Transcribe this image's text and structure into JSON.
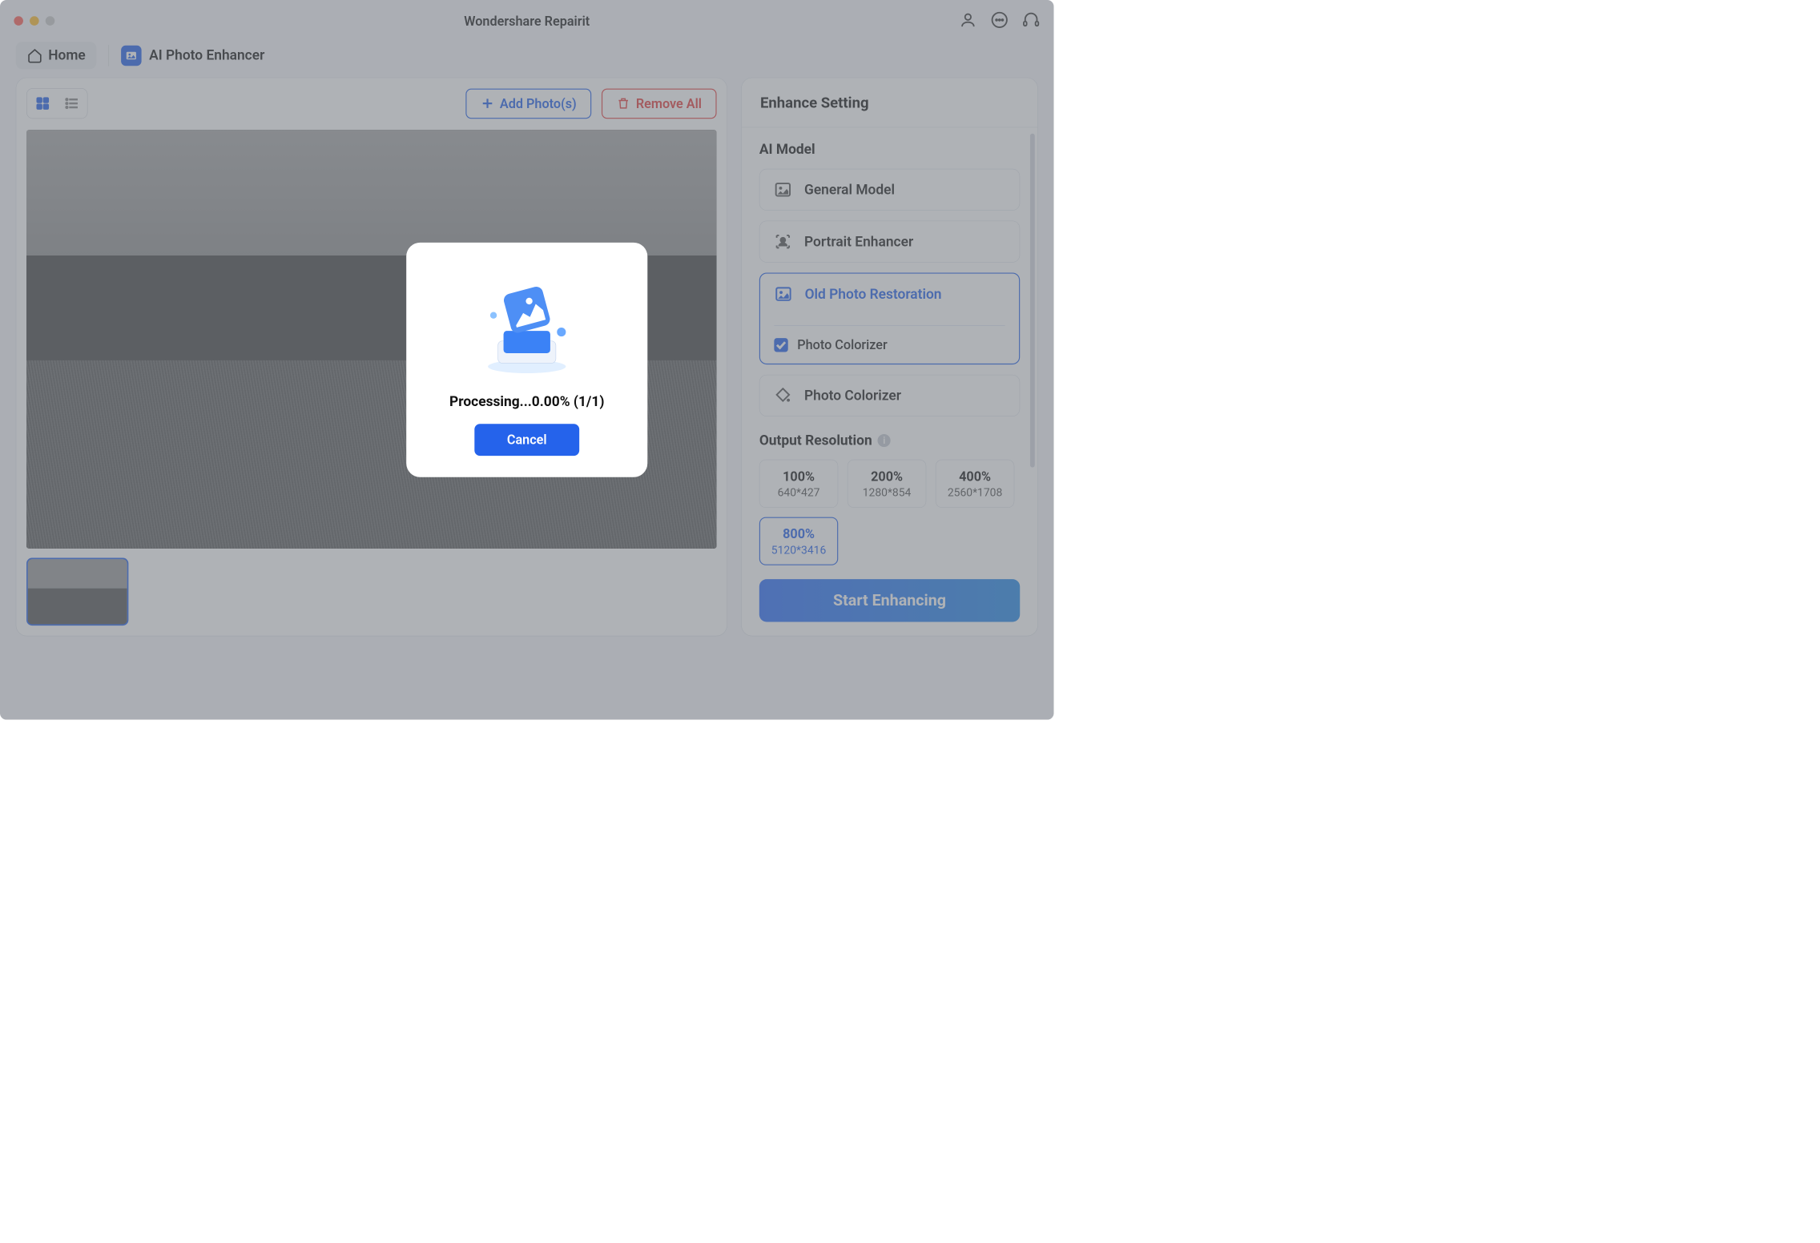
{
  "title": "Wondershare Repairit",
  "crumb": {
    "home": "Home",
    "feature": "AI Photo Enhancer"
  },
  "actions": {
    "add_photos": "Add Photo(s)",
    "remove_all": "Remove All"
  },
  "right": {
    "header": "Enhance Setting",
    "ai_model_label": "AI Model",
    "models": {
      "general": "General Model",
      "portrait": "Portrait Enhancer",
      "old_photo": "Old Photo Restoration",
      "colorizer_sub": "Photo Colorizer",
      "colorizer_card": "Photo Colorizer"
    },
    "output_res_label": "Output Resolution",
    "resolutions": [
      {
        "pct": "100%",
        "dim": "640*427"
      },
      {
        "pct": "200%",
        "dim": "1280*854"
      },
      {
        "pct": "400%",
        "dim": "2560*1708"
      },
      {
        "pct": "800%",
        "dim": "5120*3416"
      }
    ],
    "start": "Start Enhancing"
  },
  "modal": {
    "text": "Processing...0.00% (1/1)",
    "cancel": "Cancel"
  }
}
